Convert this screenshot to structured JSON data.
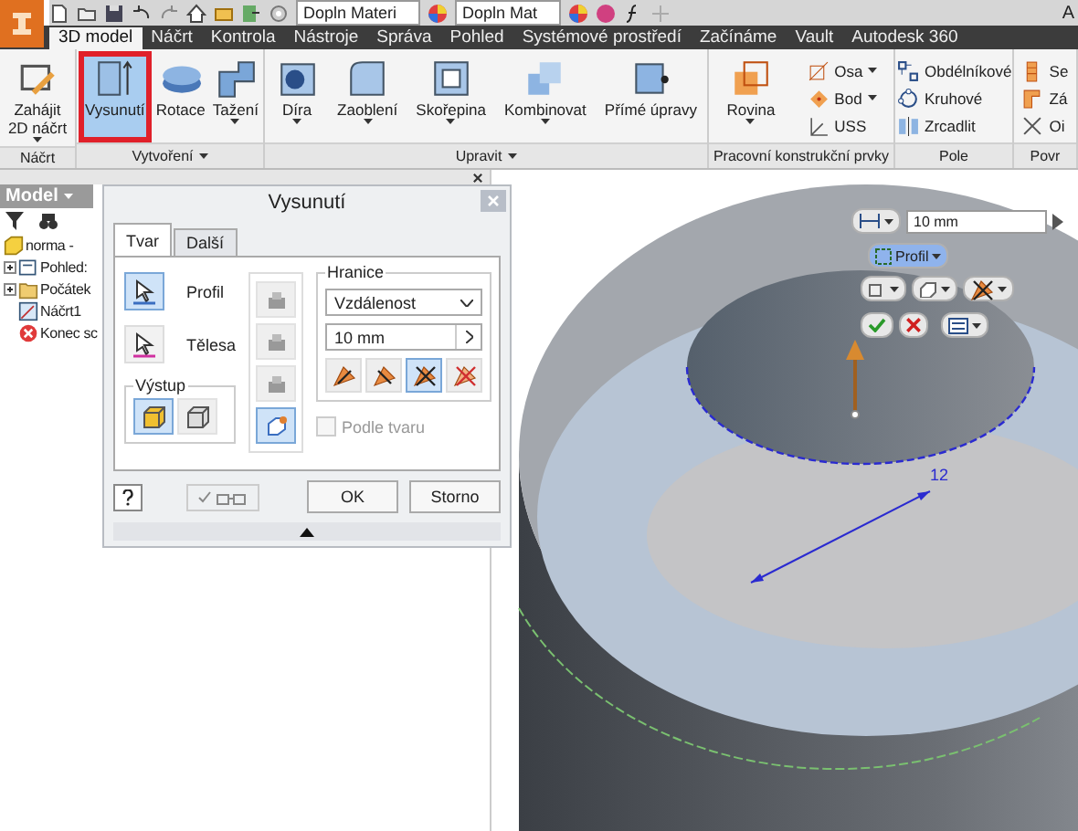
{
  "quick_access": {
    "combos": [
      "Dopln Materi",
      "Dopln Mat"
    ],
    "edge_text": "A"
  },
  "tabs": [
    {
      "label": "3D model",
      "selected": true
    },
    {
      "label": "Náčrt",
      "selected": false
    },
    {
      "label": "Kontrola",
      "selected": false
    },
    {
      "label": "Nástroje",
      "selected": false
    },
    {
      "label": "Správa",
      "selected": false
    },
    {
      "label": "Pohled",
      "selected": false
    },
    {
      "label": "Systémové prostředí",
      "selected": false
    },
    {
      "label": "Začínáme",
      "selected": false
    },
    {
      "label": "Vault",
      "selected": false
    },
    {
      "label": "Autodesk 360",
      "selected": false
    }
  ],
  "ribbon": [
    {
      "label": "Náčrt",
      "menu": false,
      "buttons": [
        {
          "kind": "large",
          "label": "Zahájit\n2D náčrt",
          "dropdown": true,
          "selected": false
        }
      ]
    },
    {
      "label": "Vytvoření",
      "menu": true,
      "buttons": [
        {
          "kind": "large",
          "label": "Vysunutí",
          "dropdown": false,
          "selected": true
        },
        {
          "kind": "large",
          "label": "Rotace",
          "dropdown": false,
          "selected": false
        },
        {
          "kind": "large",
          "label": "Tažení",
          "dropdown": true,
          "selected": false
        }
      ]
    },
    {
      "label": "Upravit",
      "menu": true,
      "buttons": [
        {
          "kind": "large",
          "label": "Díra",
          "dropdown": true,
          "selected": false
        },
        {
          "kind": "large",
          "label": "Zaoblení",
          "dropdown": true,
          "selected": false
        },
        {
          "kind": "large",
          "label": "Skořepina",
          "dropdown": true,
          "selected": false
        },
        {
          "kind": "large",
          "label": "Kombinovat",
          "dropdown": true,
          "selected": false
        },
        {
          "kind": "large",
          "label": "Přímé úpravy",
          "dropdown": false,
          "selected": false
        }
      ]
    },
    {
      "label": "Pracovní konstrukční prvky",
      "menu": false,
      "buttons": [
        {
          "kind": "large",
          "label": "Rovina",
          "dropdown": true,
          "selected": false
        },
        {
          "kind": "small",
          "label": "Osa",
          "dropdown": true,
          "selected": false
        },
        {
          "kind": "small",
          "label": "Bod",
          "dropdown": true,
          "selected": false
        },
        {
          "kind": "small",
          "label": "USS",
          "dropdown": false,
          "selected": false
        }
      ]
    },
    {
      "label": "Pole",
      "menu": false,
      "buttons": [
        {
          "kind": "small",
          "label": "Obdélníkové",
          "dropdown": false,
          "selected": false
        },
        {
          "kind": "small",
          "label": "Kruhové",
          "dropdown": false,
          "selected": false
        },
        {
          "kind": "small",
          "label": "Zrcadlit",
          "dropdown": false,
          "selected": false
        }
      ]
    },
    {
      "label": "Povr",
      "menu": false,
      "buttons": [
        {
          "kind": "small",
          "label": "Se",
          "dropdown": false,
          "selected": false
        },
        {
          "kind": "small",
          "label": "Zá",
          "dropdown": false,
          "selected": false
        },
        {
          "kind": "small",
          "label": "Oi",
          "dropdown": false,
          "selected": false
        }
      ]
    }
  ],
  "browser": {
    "title": "Model",
    "tree": [
      {
        "label": "norma -",
        "children": [
          {
            "label": "Pohled:",
            "expandable": true
          },
          {
            "label": "Počátek",
            "expandable": true
          },
          {
            "label": "Náčrt1",
            "expandable": false
          },
          {
            "label": "Konec sc",
            "expandable": false
          }
        ]
      }
    ]
  },
  "dialog": {
    "title": "Vysunutí",
    "tabs": [
      {
        "label": "Tvar",
        "selected": true
      },
      {
        "label": "Další",
        "selected": false
      }
    ],
    "selectors": [
      {
        "label": "Profil",
        "selected": true
      },
      {
        "label": "Tělesa",
        "selected": false
      }
    ],
    "output": {
      "label": "Výstup",
      "options": [
        {
          "selected": true
        },
        {
          "selected": false
        }
      ]
    },
    "operations": [
      {
        "selected": false
      },
      {
        "selected": false
      },
      {
        "selected": false
      },
      {
        "selected": true
      }
    ],
    "extents": {
      "label": "Hranice",
      "type": "Vzdálenost",
      "distance": "10 mm",
      "directions": [
        {
          "selected": false
        },
        {
          "selected": false
        },
        {
          "selected": true
        },
        {
          "selected": false
        }
      ]
    },
    "match_shape": {
      "label": "Podle tvaru",
      "checked": false,
      "disabled": true
    },
    "preview_checked": true,
    "buttons": [
      "OK",
      "Storno"
    ]
  },
  "viewport": {
    "distance": "10 mm",
    "profile": "Profil",
    "dimension": "12"
  }
}
